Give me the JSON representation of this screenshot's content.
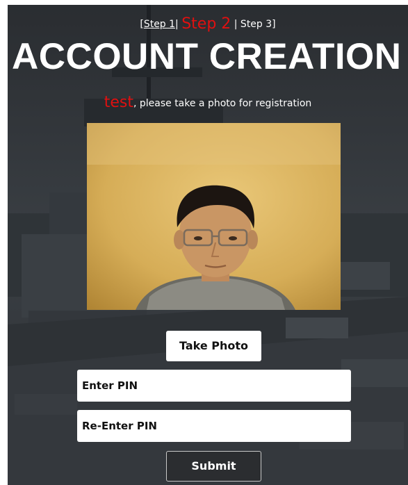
{
  "header": {
    "step1_label": "Step 1",
    "separator1": "|",
    "step2_label": "Step 2",
    "step3_label": "| Step 3]",
    "bracket_open": "["
  },
  "title": "ACCOUNT CREATION",
  "prompt": {
    "username": "test",
    "message": ", please take a photo for registration"
  },
  "buttons": {
    "take_photo": "Take Photo",
    "submit": "Submit"
  },
  "fields": {
    "pin": "Enter PIN",
    "re_pin": "Re-Enter PIN"
  },
  "colors": {
    "accent": "#e01010",
    "background": "#2b2e31"
  }
}
